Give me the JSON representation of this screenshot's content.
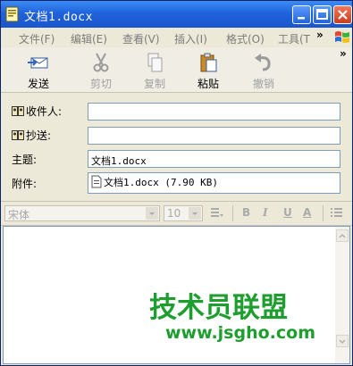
{
  "window": {
    "title": "文档1.docx"
  },
  "menu": {
    "items": [
      {
        "label": "文件(F)"
      },
      {
        "label": "编辑(E)"
      },
      {
        "label": "查看(V)"
      },
      {
        "label": "插入(I)"
      },
      {
        "label": "格式(O)"
      },
      {
        "label": "工具(T"
      }
    ],
    "overflow": "»"
  },
  "toolbar": {
    "send": "发送",
    "cut": "剪切",
    "copy": "复制",
    "paste": "粘贴",
    "undo": "撤销",
    "overflow": "»"
  },
  "fields": {
    "to_label": "收件人:",
    "cc_label": "抄送:",
    "subject_label": "主题:",
    "subject_value": "文档1.docx",
    "attach_label": "附件:",
    "attachment": "文档1.docx (7.90 KB)"
  },
  "format": {
    "font": "宋体",
    "size": "10",
    "bold": "B",
    "italic": "I",
    "underline": "U",
    "color": "A"
  },
  "watermark": {
    "text": "技术员联盟",
    "url": "www.jsgho.com"
  },
  "colors": {
    "titlebar": "#1f63dc",
    "close": "#c93d1b",
    "watermark": "#1d9e2e"
  }
}
